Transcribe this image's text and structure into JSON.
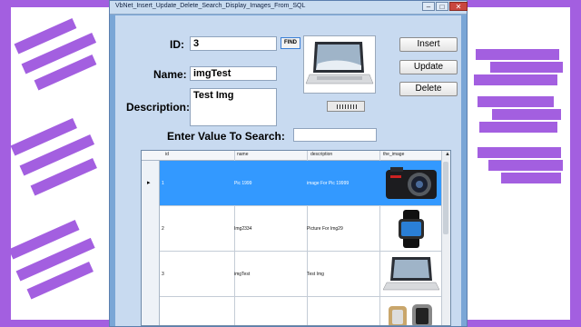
{
  "window": {
    "title": "VbNet_Insert_Update_Delete_Search_Display_Images_From_SQL",
    "minimize": "–",
    "maximize": "□",
    "close": "✕"
  },
  "form": {
    "id_label": "ID:",
    "id_value": "3",
    "find_button": "FIND",
    "name_label": "Name:",
    "name_value": "imgTest",
    "description_label": "Description:",
    "description_value": "Test Img",
    "search_label": "Enter Value To Search:",
    "search_value": ""
  },
  "buttons": {
    "insert": "Insert",
    "update": "Update",
    "delete": "Delete"
  },
  "grid": {
    "columns": [
      "id",
      "name",
      "description",
      "the_image"
    ],
    "rows": [
      {
        "id": "1",
        "name": "Pic 1999",
        "description": "image For Pic 19999",
        "image": "camera-image",
        "selected": true
      },
      {
        "id": "2",
        "name": "Img2334",
        "description": "Picture For Img29",
        "image": "smartwatch-image",
        "selected": false
      },
      {
        "id": "3",
        "name": "imgTest",
        "description": "Test Img",
        "image": "laptop-image",
        "selected": false
      },
      {
        "id": "",
        "name": "",
        "description": "",
        "image": "watch-image",
        "selected": false
      }
    ],
    "current_row_marker": "▸"
  },
  "colors": {
    "accent_purple": "#a35fe0",
    "window_frame": "#7aa6d6",
    "client_bg": "#c8daf0",
    "selection": "#3399ff"
  }
}
